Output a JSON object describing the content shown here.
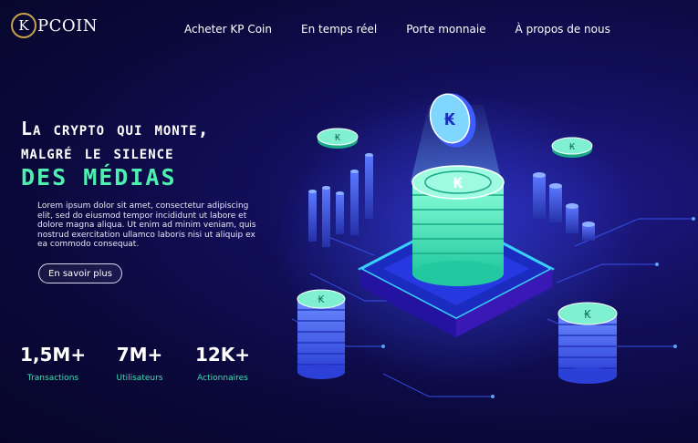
{
  "header": {
    "logo": {
      "icon_letter": "K",
      "text": "PCOIN"
    },
    "nav": [
      "Acheter KP Coin",
      "En temps réel",
      "Porte monnaie",
      "À propos de nous"
    ]
  },
  "hero": {
    "title_lines": [
      "La crypto qui monte,",
      "malgré le silence"
    ],
    "title_accent": "des médias",
    "description": "Lorem ipsum dolor sit amet, consectetur adipiscing elit, sed do eiusmod tempor incididunt ut labore et dolore magna aliqua. Ut enim ad minim veniam, quis nostrud exercitation ullamco laboris nisi ut aliquip ex ea commodo consequat.",
    "cta_label": "En savoir plus"
  },
  "stats": [
    {
      "value": "1,5M+",
      "label": "Transactions"
    },
    {
      "value": "7M+",
      "label": "Utilisateurs"
    },
    {
      "value": "12K+",
      "label": "Actionnaires"
    }
  ],
  "colors": {
    "accent": "#4ef0b0",
    "background": "#0a0838",
    "coin": "#3fe6c0",
    "bars": "#3a5cff"
  },
  "icons": [
    "kp-coin-icon",
    "coin-stack-icon",
    "bar-chart-icon"
  ]
}
